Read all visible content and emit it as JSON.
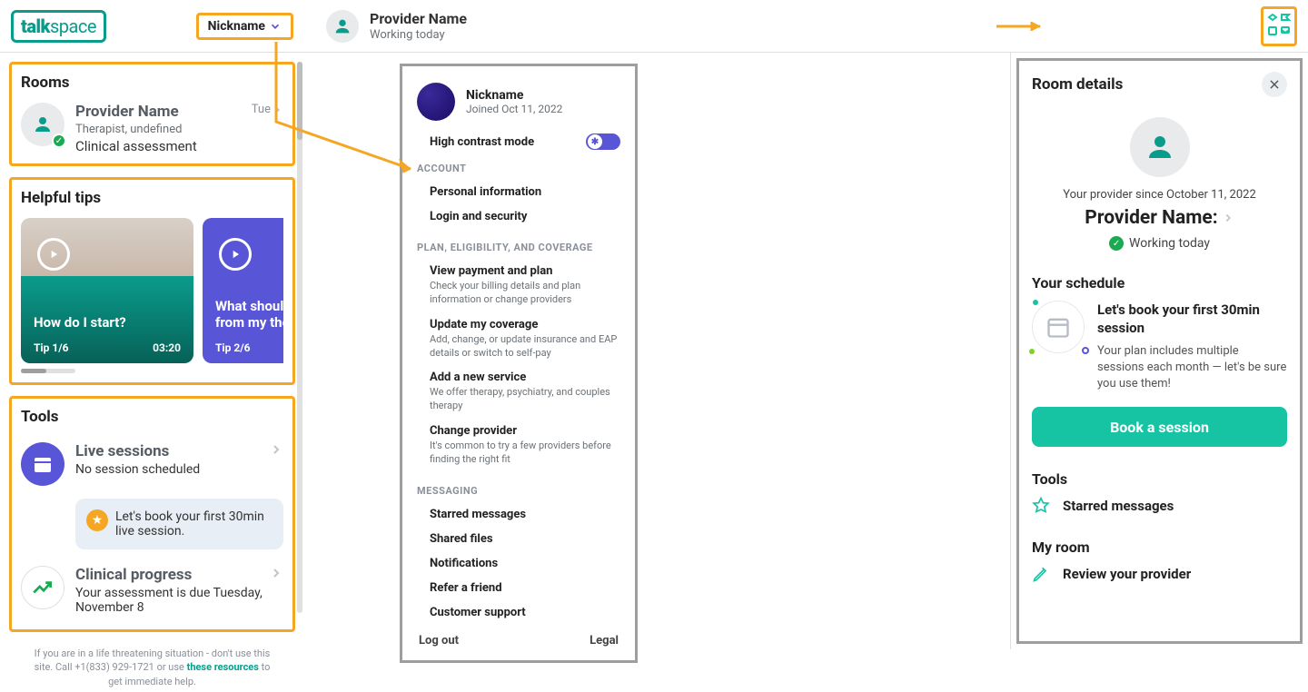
{
  "header": {
    "logo_prefix": "talk",
    "logo_suffix": "space",
    "nickname_label": "Nickname",
    "provider_name": "Provider Name",
    "provider_status": "Working today"
  },
  "sidebar": {
    "rooms_title": "Rooms",
    "room": {
      "provider": "Provider Name",
      "role": "Therapist, undefined",
      "assessment": "Clinical assessment",
      "day": "Tue"
    },
    "tips_title": "Helpful tips",
    "tips": [
      {
        "title": "How do I start?",
        "meta": "Tip 1/6",
        "dur": "03:20"
      },
      {
        "title": "What should I expect from my thera...",
        "meta": "Tip 2/6",
        "dur": ""
      }
    ],
    "tools_title": "Tools",
    "tools": {
      "live_title": "Live sessions",
      "live_sub": "No session scheduled",
      "callout": "Let's book your first 30min live session.",
      "clinical_title": "Clinical progress",
      "clinical_sub": "Your assessment is due Tuesday, November 8"
    },
    "footer_a": "If you are in a life threatening situation - don't use this site. Call +1(833) 929-1721 or use ",
    "footer_link": "these resources",
    "footer_b": " to get immediate help."
  },
  "dropdown": {
    "nickname": "Nickname",
    "joined": "Joined Oct 11, 2022",
    "hcm": "High contrast mode",
    "section_account": "ACCOUNT",
    "acct_personal": "Personal information",
    "acct_login": "Login and security",
    "section_plan": "PLAN, ELIGIBILITY, AND COVERAGE",
    "plan_view_t": "View payment and plan",
    "plan_view_s": "Check your billing details and plan information or change providers",
    "plan_update_t": "Update my coverage",
    "plan_update_s": "Add, change, or update insurance and EAP details or switch to self-pay",
    "plan_add_t": "Add a new service",
    "plan_add_s": "We offer therapy, psychiatry, and couples therapy",
    "plan_change_t": "Change provider",
    "plan_change_s": "It's common to try a few providers before finding the right fit",
    "section_msg": "MESSAGING",
    "msg_starred": "Starred messages",
    "msg_shared": "Shared files",
    "msg_notif": "Notifications",
    "msg_refer": "Refer a friend",
    "msg_support": "Customer support",
    "logout": "Log out",
    "legal": "Legal"
  },
  "right": {
    "title": "Room details",
    "since": "Your provider since October 11, 2022",
    "provider": "Provider Name:",
    "status": "Working today",
    "schedule_title": "Your schedule",
    "sched_t": "Let's book your first 30min session",
    "sched_s": "Your plan includes multiple sessions each month — let's be sure you use them!",
    "book": "Book a session",
    "tools_title": "Tools",
    "starred": "Starred messages",
    "myroom_title": "My room",
    "review": "Review your provider"
  }
}
